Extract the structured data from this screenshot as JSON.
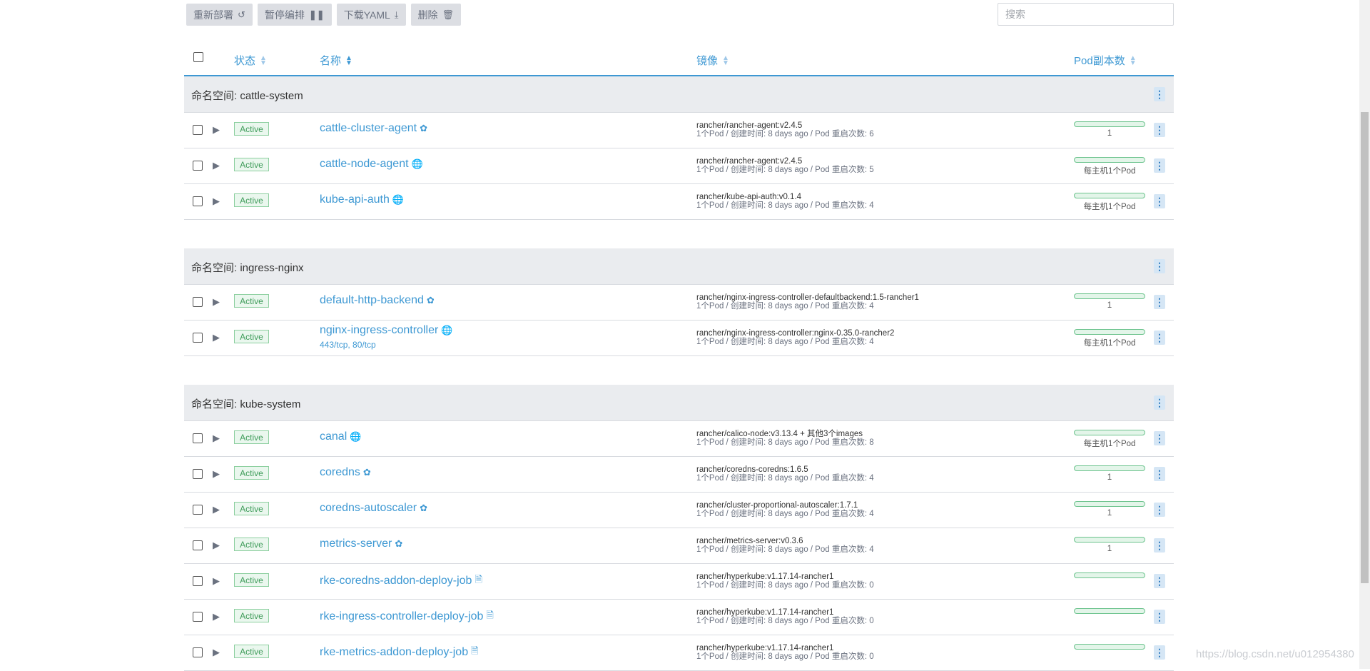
{
  "toolbar": {
    "redeploy": "重新部署",
    "pause": "暂停编排",
    "download": "下载YAML",
    "delete": "删除"
  },
  "search": {
    "placeholder": "搜索"
  },
  "columns": {
    "state": "状态",
    "name": "名称",
    "image": "镜像",
    "pods": "Pod副本数"
  },
  "groups": [
    {
      "title": "命名空间: cattle-system",
      "rows": [
        {
          "state": "Active",
          "name": "cattle-cluster-agent",
          "icon": "deployment-icon",
          "ports": "",
          "image": "rancher/rancher-agent:v2.4.5",
          "meta": "1个Pod / 创建时间: 8 days ago / Pod 重启次数: 6",
          "pods": "1"
        },
        {
          "state": "Active",
          "name": "cattle-node-agent",
          "icon": "globe-icon",
          "ports": "",
          "image": "rancher/rancher-agent:v2.4.5",
          "meta": "1个Pod / 创建时间: 8 days ago / Pod 重启次数: 5",
          "pods": "每主机1个Pod"
        },
        {
          "state": "Active",
          "name": "kube-api-auth",
          "icon": "globe-icon",
          "ports": "",
          "image": "rancher/kube-api-auth:v0.1.4",
          "meta": "1个Pod / 创建时间: 8 days ago / Pod 重启次数: 4",
          "pods": "每主机1个Pod"
        }
      ]
    },
    {
      "title": "命名空间: ingress-nginx",
      "rows": [
        {
          "state": "Active",
          "name": "default-http-backend",
          "icon": "deployment-icon",
          "ports": "",
          "image": "rancher/nginx-ingress-controller-defaultbackend:1.5-rancher1",
          "meta": "1个Pod / 创建时间: 8 days ago / Pod 重启次数: 4",
          "pods": "1"
        },
        {
          "state": "Active",
          "name": "nginx-ingress-controller",
          "icon": "globe-icon",
          "ports": "443/tcp, 80/tcp",
          "image": "rancher/nginx-ingress-controller:nginx-0.35.0-rancher2",
          "meta": "1个Pod / 创建时间: 8 days ago / Pod 重启次数: 4",
          "pods": "每主机1个Pod"
        }
      ]
    },
    {
      "title": "命名空间: kube-system",
      "rows": [
        {
          "state": "Active",
          "name": "canal",
          "icon": "globe-icon",
          "ports": "",
          "image": "rancher/calico-node:v3.13.4 + 其他3个images",
          "meta": "1个Pod / 创建时间: 8 days ago / Pod 重启次数: 8",
          "pods": "每主机1个Pod"
        },
        {
          "state": "Active",
          "name": "coredns",
          "icon": "deployment-icon",
          "ports": "",
          "image": "rancher/coredns-coredns:1.6.5",
          "meta": "1个Pod / 创建时间: 8 days ago / Pod 重启次数: 4",
          "pods": "1"
        },
        {
          "state": "Active",
          "name": "coredns-autoscaler",
          "icon": "deployment-icon",
          "ports": "",
          "image": "rancher/cluster-proportional-autoscaler:1.7.1",
          "meta": "1个Pod / 创建时间: 8 days ago / Pod 重启次数: 4",
          "pods": "1"
        },
        {
          "state": "Active",
          "name": "metrics-server",
          "icon": "deployment-icon",
          "ports": "",
          "image": "rancher/metrics-server:v0.3.6",
          "meta": "1个Pod / 创建时间: 8 days ago / Pod 重启次数: 4",
          "pods": "1"
        },
        {
          "state": "Active",
          "name": "rke-coredns-addon-deploy-job",
          "icon": "file-icon",
          "ports": "",
          "image": "rancher/hyperkube:v1.17.14-rancher1",
          "meta": "1个Pod / 创建时间: 8 days ago / Pod 重启次数: 0",
          "pods": ""
        },
        {
          "state": "Active",
          "name": "rke-ingress-controller-deploy-job",
          "icon": "file-icon",
          "ports": "",
          "image": "rancher/hyperkube:v1.17.14-rancher1",
          "meta": "1个Pod / 创建时间: 8 days ago / Pod 重启次数: 0",
          "pods": ""
        },
        {
          "state": "Active",
          "name": "rke-metrics-addon-deploy-job",
          "icon": "file-icon",
          "ports": "",
          "image": "rancher/hyperkube:v1.17.14-rancher1",
          "meta": "1个Pod / 创建时间: 8 days ago / Pod 重启次数: 0",
          "pods": ""
        }
      ]
    }
  ],
  "watermark": "https://blog.csdn.net/u012954380",
  "colors": {
    "accent": "#3d98d3",
    "active_green": "#3f9c5a",
    "group_bg": "#eaecef"
  }
}
